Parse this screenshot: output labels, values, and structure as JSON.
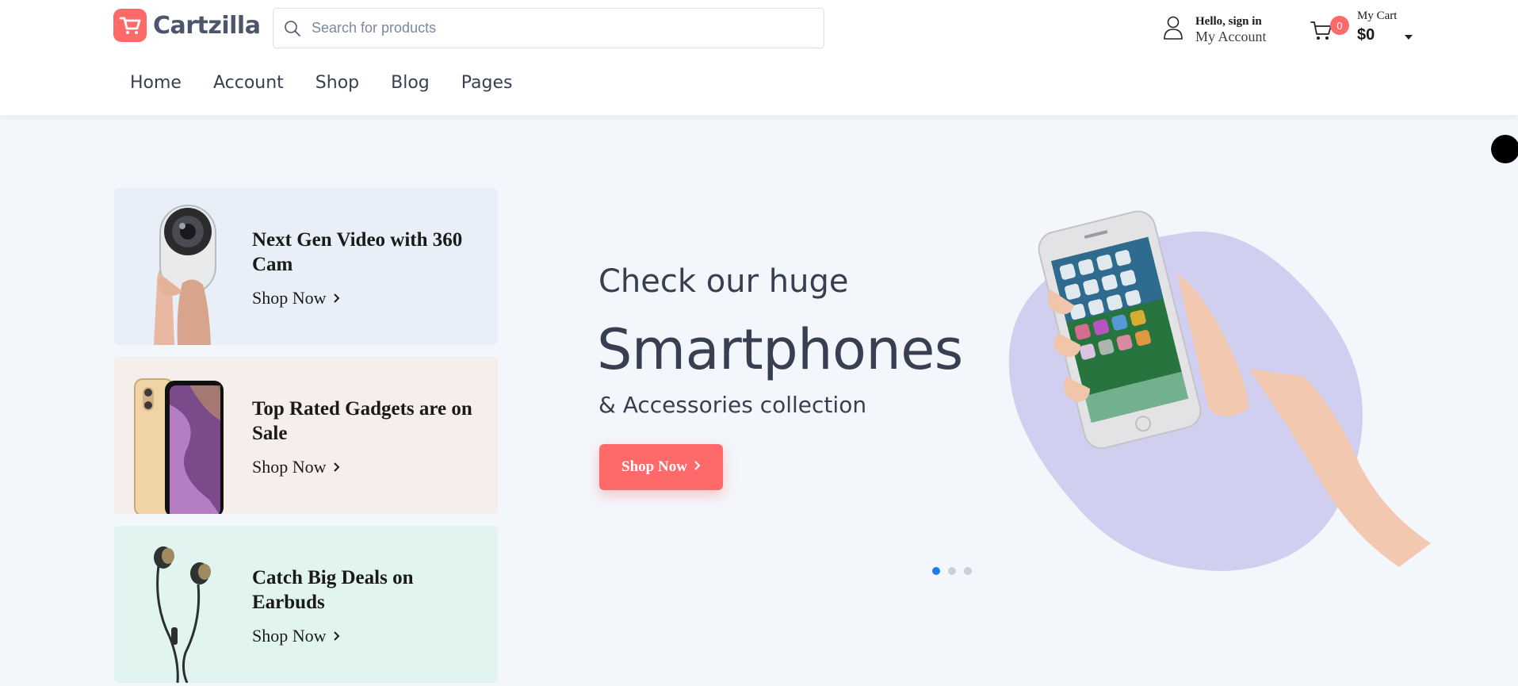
{
  "brand": {
    "name": "Cartzilla",
    "icon": "cart-logo-icon",
    "color": "#fe696a"
  },
  "search": {
    "placeholder": "Search for products",
    "value": "",
    "icon": "search-icon"
  },
  "account": {
    "greeting": "Hello, sign in",
    "label": "My Account",
    "icon": "user-icon"
  },
  "cart": {
    "label": "My Cart",
    "total": "$0",
    "count": "0",
    "icon": "cart-icon"
  },
  "nav": {
    "items": [
      {
        "label": "Home"
      },
      {
        "label": "Account"
      },
      {
        "label": "Shop"
      },
      {
        "label": "Blog"
      },
      {
        "label": "Pages"
      }
    ]
  },
  "promos": [
    {
      "title": "Next Gen Video with 360 Cam",
      "link": "Shop Now",
      "image": "360-camera-image"
    },
    {
      "title": "Top Rated Gadgets are on Sale",
      "link": "Shop Now",
      "image": "smartphone-image"
    },
    {
      "title": "Catch Big Deals on Earbuds",
      "link": "Shop Now",
      "image": "earbuds-image"
    }
  ],
  "hero": {
    "subtitle1": "Check our huge",
    "title": "Smartphones",
    "subtitle2": "& Accessories collection",
    "button": "Shop Now",
    "image": "hand-holding-phone-image",
    "blob_color": "#d0cff0"
  },
  "carousel": {
    "slides": 3,
    "active": 1
  },
  "colors": {
    "accent": "#fe696a",
    "text": "#373f50",
    "active_dot": "#1e7bf2"
  }
}
